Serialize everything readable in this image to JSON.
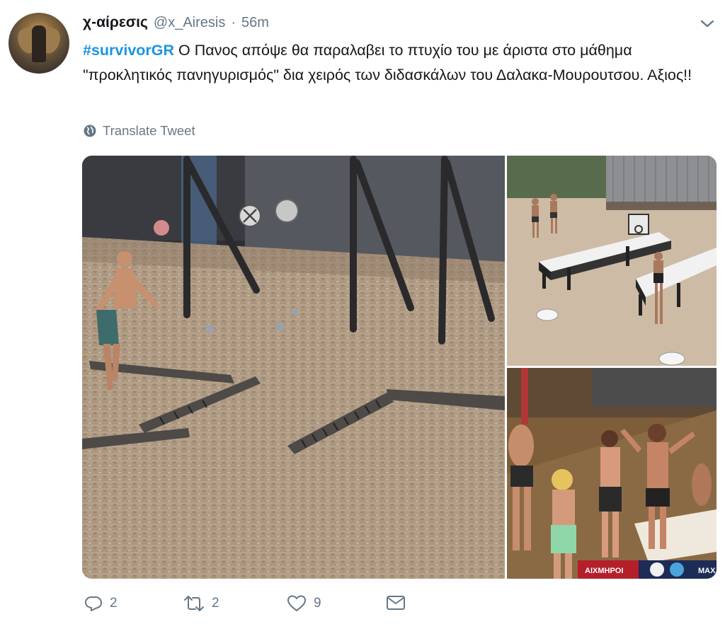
{
  "tweet": {
    "author_name": "χ-αίρεσις",
    "handle": "@x_Airesis",
    "separator": "·",
    "time": "56m",
    "hashtag": "#survivorGR",
    "body": " Ο Πανος απόψε θα παραλαβει το πτυχίο του με άριστα στο μάθημα \"προκλητικός πανηγυρισμός\" δια χειρός των διδασκάλων του Δαλακα-Μουρουτσου. Αξιος!!",
    "translate_label": "Translate Tweet"
  },
  "media": {
    "scoreboard_left": "ΑΙΧΜΗΡΟΙ",
    "scoreboard_right": "ΜΑΧ"
  },
  "actions": {
    "reply_count": "2",
    "retweet_count": "2",
    "like_count": "9"
  },
  "icons": [
    "chevron-down-icon",
    "globe-icon",
    "reply-icon",
    "retweet-icon",
    "heart-icon",
    "mail-icon"
  ],
  "colors": {
    "hashtag": "#1b95e0",
    "secondary_text": "#657786",
    "primary_text": "#14171a"
  }
}
